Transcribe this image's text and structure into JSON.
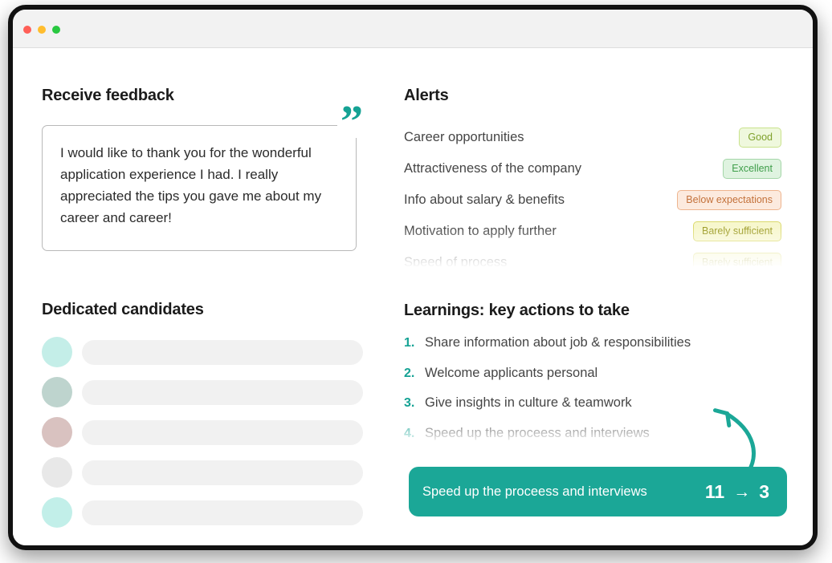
{
  "window": {
    "traffic_lights": [
      "close",
      "minimize",
      "maximize"
    ]
  },
  "feedback": {
    "title": "Receive feedback",
    "quote_icon": "quote-mark-icon",
    "quote": "I would like to thank you for the wonderful application experience I had. I really appreciated the tips you gave me about my career and career!"
  },
  "alerts": {
    "title": "Alerts",
    "rows": [
      {
        "label": "Career opportunities",
        "badge": "Good",
        "style": "badge-good"
      },
      {
        "label": "Attractiveness of the company",
        "badge": "Excellent",
        "style": "badge-excellent"
      },
      {
        "label": "Info about salary & benefits",
        "badge": "Below expectations",
        "style": "badge-below"
      },
      {
        "label": "Motivation to apply further",
        "badge": "Barely sufficient",
        "style": "badge-barely"
      },
      {
        "label": "Speed of process",
        "badge": "Barely sufficient",
        "style": "badge-barely"
      }
    ]
  },
  "candidates": {
    "title": "Dedicated candidates",
    "rows": [
      {
        "avatar_color": "#c4eee8"
      },
      {
        "avatar_color": "#bed4ce"
      },
      {
        "avatar_color": "#d9c2c0"
      },
      {
        "avatar_color": "#e8e8e8"
      },
      {
        "avatar_color": "#c2efe9"
      }
    ]
  },
  "learnings": {
    "title": "Learnings: key actions to take",
    "items": [
      {
        "number": "1.",
        "text": "Share information about job & responsibilities"
      },
      {
        "number": "2.",
        "text": "Welcome applicants personal"
      },
      {
        "number": "3.",
        "text": "Give insights in culture & teamwork"
      },
      {
        "number": "4.",
        "text": "Speed up the proceess and interviews"
      }
    ]
  },
  "banner": {
    "label": "Speed up the proceess and interviews",
    "from": "11",
    "arrow": "→",
    "to": "3",
    "color": "#1ba797"
  },
  "arrow_annotation": {
    "icon": "curved-arrow-icon",
    "color": "#1ba797"
  }
}
